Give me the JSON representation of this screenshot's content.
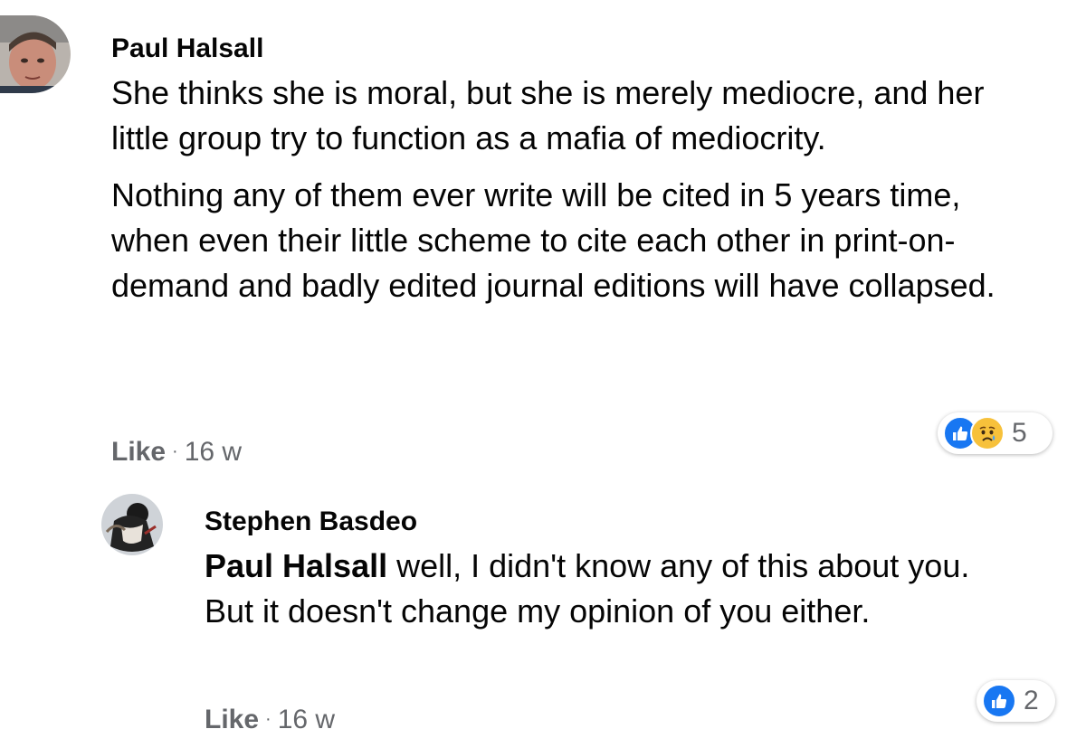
{
  "comments": [
    {
      "author": "Paul Halsall",
      "paragraphs": [
        "She thinks she is moral, but she is merely mediocre, and her little group try to function as a mafia of mediocrity.",
        "Nothing any of them ever write will be cited in 5 years time, when even their little scheme to cite each other in print-on-demand and badly edited journal editions will have collapsed."
      ],
      "like_label": "Like",
      "separator": "·",
      "time": "16 w",
      "reactions": {
        "icons": [
          "like-icon",
          "sad-icon"
        ],
        "count": "5"
      }
    },
    {
      "author": "Stephen Basdeo",
      "mention": "Paul Halsall",
      "text": " well, I didn't know any of this about you. But it doesn't change my opinion of you either.",
      "like_label": "Like",
      "separator": "·",
      "time": "16 w",
      "reactions": {
        "icons": [
          "like-icon"
        ],
        "count": "2"
      }
    }
  ],
  "colors": {
    "like_blue": "#1877f2",
    "sad_yellow": "#f7c13b",
    "meta_gray": "#65676b"
  }
}
